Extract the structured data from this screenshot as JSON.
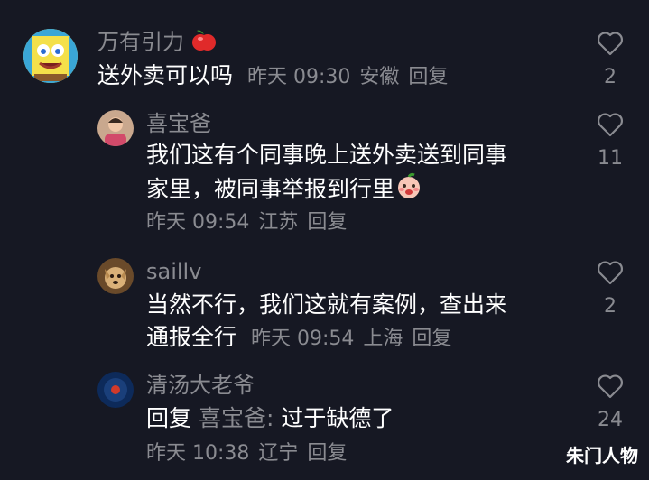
{
  "comments": [
    {
      "username": "万有引力",
      "username_emoji": "apple-emoji",
      "text_lines": [
        "送外卖可以吗"
      ],
      "time": "昨天 09:30",
      "location": "安徽",
      "reply_label": "回复",
      "likes": "2",
      "avatar": "spongebob-avatar"
    },
    {
      "username": "喜宝爸",
      "text_lines": [
        "我们这有个同事晚上送外卖送到同事",
        "家里，被同事举报到行里"
      ],
      "text_emoji": "embarrassed-emoji",
      "time": "昨天 09:54",
      "location": "江苏",
      "reply_label": "回复",
      "likes": "11",
      "avatar": "person-avatar"
    },
    {
      "username": "saillv",
      "text_lines": [
        "当然不行，我们这就有案例，查出来",
        "通报全行"
      ],
      "time": "昨天 09:54",
      "location": "上海",
      "reply_label": "回复",
      "likes": "2",
      "avatar": "dog-avatar"
    },
    {
      "username": "清汤大老爷",
      "reply_prefix": "回复",
      "reply_to": "喜宝爸:",
      "text_after": "过于缺德了",
      "time": "昨天 10:38",
      "location": "辽宁",
      "reply_label": "回复",
      "likes": "24",
      "avatar": "blue-circle-avatar"
    }
  ],
  "watermark": "朱门人物",
  "colors": {
    "background": "#161823",
    "secondary_text": "#8a8b91",
    "primary_text": "#ffffff"
  }
}
